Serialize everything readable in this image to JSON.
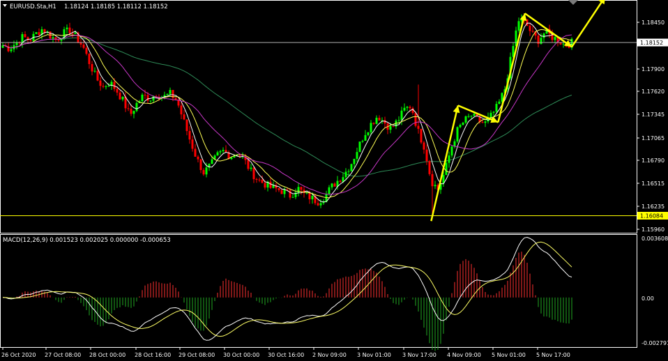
{
  "chart_data": {
    "type": "candlestick",
    "header": {
      "symbol": "EURUSD.Sta,H1",
      "quote": "1.18124 1.18185 1.18112 1.18152"
    },
    "price_ticks": [
      "1.18450",
      "1.17900",
      "1.17620",
      "1.17345",
      "1.17065",
      "1.16790",
      "1.16515",
      "1.16235",
      "1.15960"
    ],
    "price_ylim": [
      1.1588,
      1.1866
    ],
    "current_price": {
      "label": "1.18152",
      "value": 1.18152
    },
    "support_line": {
      "label": "1.16084",
      "value": 1.16084
    },
    "x_labels": [
      "26 Oct 2020",
      "27 Oct 08:00",
      "28 Oct 00:00",
      "28 Oct 16:00",
      "29 Oct 08:00",
      "30 Oct 00:00",
      "30 Oct 16:00",
      "2 Nov 09:00",
      "3 Nov 01:00",
      "3 Nov 17:00",
      "4 Nov 09:00",
      "5 Nov 01:00",
      "5 Nov 17:00"
    ],
    "close_path": [
      1.1812,
      1.1808,
      1.1815,
      1.1822,
      1.1818,
      1.1826,
      1.1832,
      1.1824,
      1.1818,
      1.1826,
      1.183,
      1.1821,
      1.181,
      1.179,
      1.1772,
      1.1762,
      1.1768,
      1.1758,
      1.1745,
      1.1728,
      1.1742,
      1.1752,
      1.1748,
      1.1755,
      1.175,
      1.1754,
      1.1746,
      1.1722,
      1.1698,
      1.1676,
      1.166,
      1.1668,
      1.168,
      1.1686,
      1.1679,
      1.1683,
      1.1676,
      1.1662,
      1.1652,
      1.1647,
      1.1642,
      1.164,
      1.1637,
      1.1632,
      1.1642,
      1.1634,
      1.163,
      1.1625,
      1.163,
      1.1642,
      1.165,
      1.1658,
      1.167,
      1.1688,
      1.1706,
      1.1718,
      1.1728,
      1.172,
      1.1712,
      1.1722,
      1.1735,
      1.174,
      1.171,
      1.169,
      1.165,
      1.164,
      1.166,
      1.169,
      1.1712,
      1.1722,
      1.1728,
      1.1722,
      1.1718,
      1.1728,
      1.174,
      1.176,
      1.18,
      1.1842,
      1.184,
      1.1826,
      1.1818,
      1.1828,
      1.1822,
      1.1818,
      1.1812,
      1.1815
    ],
    "moving_averages": [
      {
        "color": "#ffffff",
        "period": 5
      },
      {
        "color": "#ffff55",
        "period": 10
      },
      {
        "color": "#c837c8",
        "period": 21
      },
      {
        "color": "#2e8b57",
        "period": 60
      }
    ],
    "arrows": [
      {
        "from": [
          64,
          1.1602
        ],
        "to": [
          68,
          1.174
        ]
      },
      {
        "from": [
          68,
          1.174
        ],
        "to": [
          74,
          1.172
        ]
      },
      {
        "from": [
          74,
          1.172
        ],
        "to": [
          78,
          1.185
        ]
      },
      {
        "from": [
          78,
          1.185
        ],
        "to": [
          85,
          1.181
        ]
      },
      {
        "from": [
          85,
          1.181
        ],
        "to": [
          90,
          1.187
        ]
      }
    ],
    "macd": {
      "label": "MACD(12,26,9) 0.001523 0.002025 0.000000 -0.000653",
      "ticks": [
        "0.003608",
        "0.00",
        "-0.002791"
      ],
      "ylim": [
        -0.0029,
        0.0037
      ]
    },
    "colors": {
      "bull": "#00ff00",
      "bear": "#ff0000",
      "grid_frame": "#ffffff",
      "current_line": "#b0b0b0",
      "support": "#ffff00",
      "arrows": "#ffff00",
      "macd_line": "#ffffff",
      "signal_line": "#ffff66",
      "hist_pos": "#ff3030",
      "hist_neg": "#22aa22"
    }
  }
}
